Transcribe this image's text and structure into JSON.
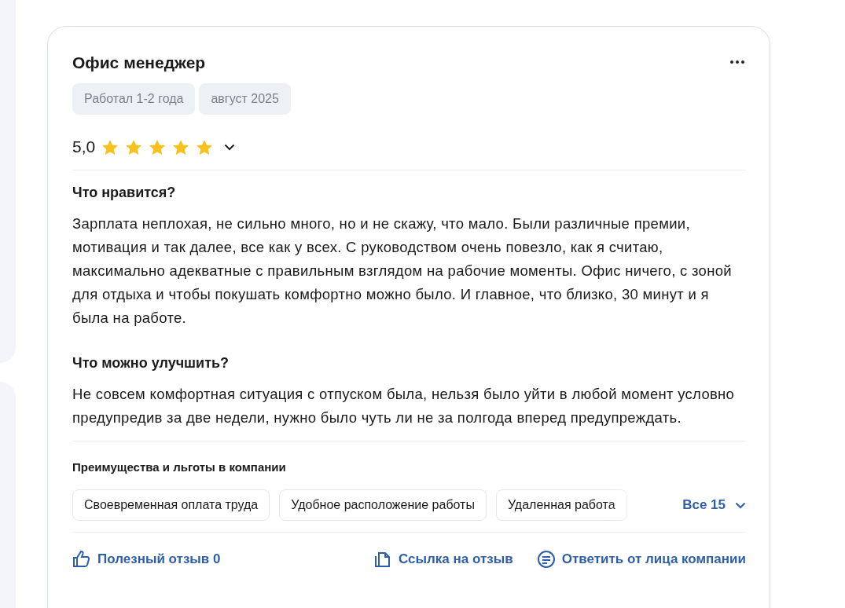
{
  "review": {
    "title": "Офис менеджер",
    "tags": [
      "Работал 1-2 года",
      "август 2025"
    ],
    "rating": {
      "value": "5,0",
      "stars": 5
    },
    "sections": [
      {
        "heading": "Что нравится?",
        "text": "Зарплата неплохая, не сильно много, но и не скажу, что мало. Были различные премии, мотивация и так далее, все как у всех. С руководством очень повезло, как я считаю, максимально адекватные с правильным взглядом на рабочие моменты. Офис ничего, с зоной для отдыха и чтобы покушать комфортно можно было. И главное, что близко, 30 минут и я была на работе."
      },
      {
        "heading": "Что можно улучшить?",
        "text": "Не совсем комфортная ситуация с отпуском была, нельзя было уйти в любой момент условно предупредив за две недели, нужно было чуть ли не за полгода вперед предупреждать."
      }
    ],
    "benefits": {
      "heading": "Преимущества и льготы в компании",
      "items": [
        "Своевременная оплата труда",
        "Удобное расположение работы",
        "Удаленная работа"
      ],
      "more": "Все 15"
    },
    "actions": [
      {
        "kind": "like",
        "label": "Полезный отзыв 0"
      },
      {
        "kind": "link",
        "label": "Ссылка на отзыв"
      },
      {
        "kind": "reply",
        "label": "Ответить от лица компании"
      }
    ]
  }
}
